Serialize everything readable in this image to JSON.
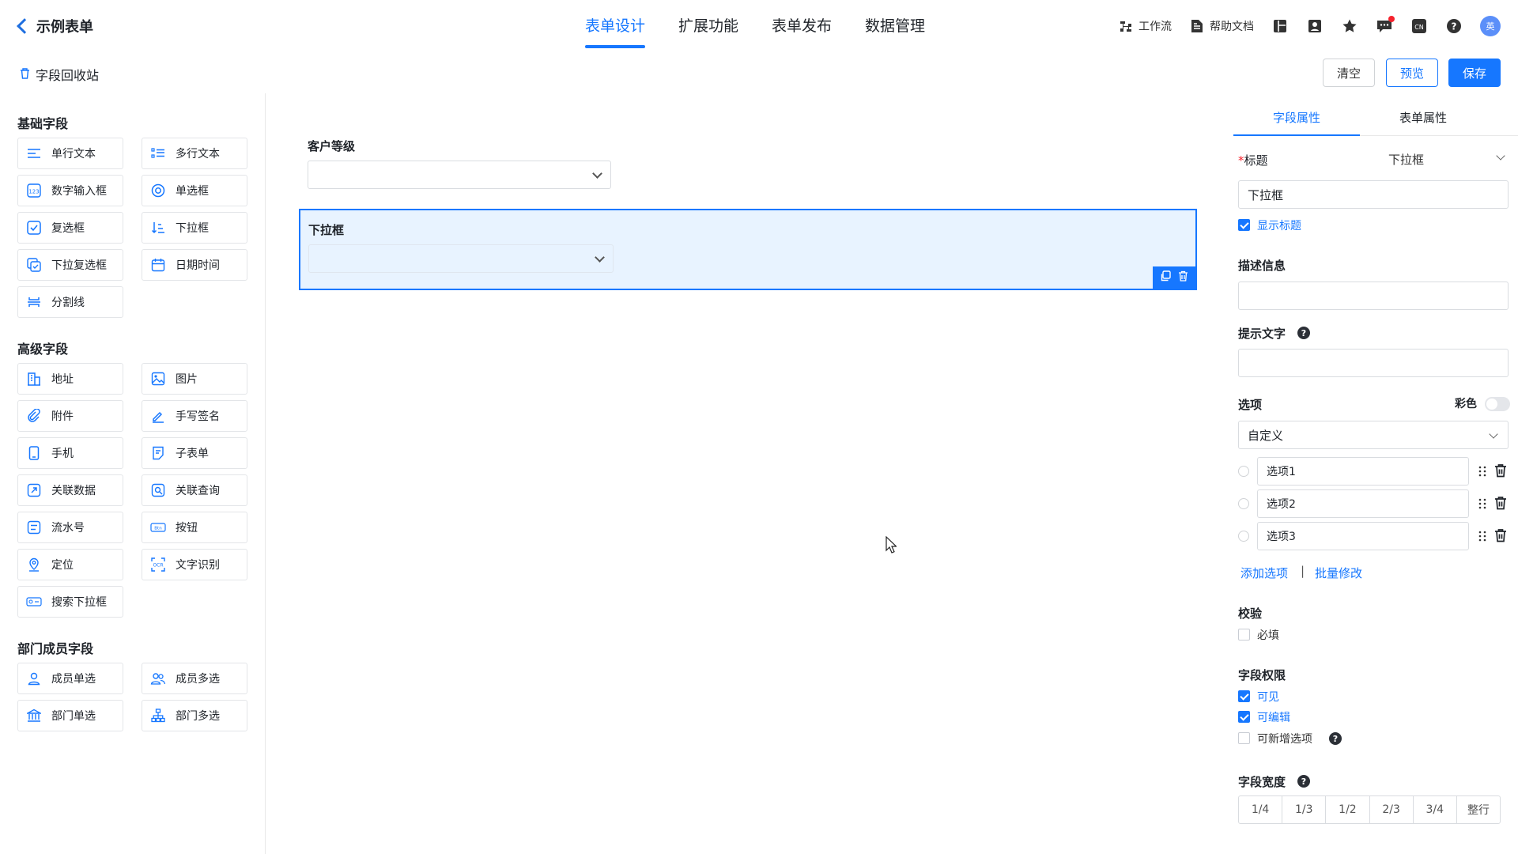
{
  "header": {
    "back_title": "示例表单",
    "tabs": [
      {
        "label": "表单设计"
      },
      {
        "label": "扩展功能"
      },
      {
        "label": "表单发布"
      },
      {
        "label": "数据管理"
      }
    ],
    "workflow_label": "工作流",
    "help_label": "帮助文档",
    "avatar_text": "英"
  },
  "toolbar": {
    "recycle_label": "字段回收站",
    "clear_label": "清空",
    "preview_label": "预览",
    "save_label": "保存"
  },
  "sidebar": {
    "groups": [
      {
        "title": "基础字段",
        "items": [
          "单行文本",
          "多行文本",
          "数字输入框",
          "单选框",
          "复选框",
          "下拉框",
          "下拉复选框",
          "日期时间",
          "分割线"
        ]
      },
      {
        "title": "高级字段",
        "items": [
          "地址",
          "图片",
          "附件",
          "手写签名",
          "手机",
          "子表单",
          "关联数据",
          "关联查询",
          "流水号",
          "按钮",
          "定位",
          "文字识别",
          "搜索下拉框"
        ]
      },
      {
        "title": "部门成员字段",
        "items": [
          "成员单选",
          "成员多选",
          "部门单选",
          "部门多选"
        ]
      }
    ]
  },
  "canvas": {
    "field1_label": "客户等级",
    "field2_label": "下拉框"
  },
  "panel": {
    "tab_field": "字段属性",
    "tab_form": "表单属性",
    "title_label": "标题",
    "required_mark": "*",
    "title_type_value": "下拉框",
    "title_value": "下拉框",
    "show_title_label": "显示标题",
    "desc_label": "描述信息",
    "hint_label": "提示文字",
    "options_label": "选项",
    "color_label": "彩色",
    "options_source": "自定义",
    "options": [
      "选项1",
      "选项2",
      "选项3"
    ],
    "add_option": "添加选项",
    "separator": "|",
    "batch_edit": "批量修改",
    "validation_label": "校验",
    "required_label": "必填",
    "permission_label": "字段权限",
    "visible_label": "可见",
    "editable_label": "可编辑",
    "addable_label": "可新增选项",
    "width_label": "字段宽度",
    "widths": [
      "1/4",
      "1/3",
      "1/2",
      "2/3",
      "3/4",
      "整行"
    ]
  },
  "colors": {
    "accent": "#1677ff",
    "selected_bg": "#e8f3ff"
  }
}
